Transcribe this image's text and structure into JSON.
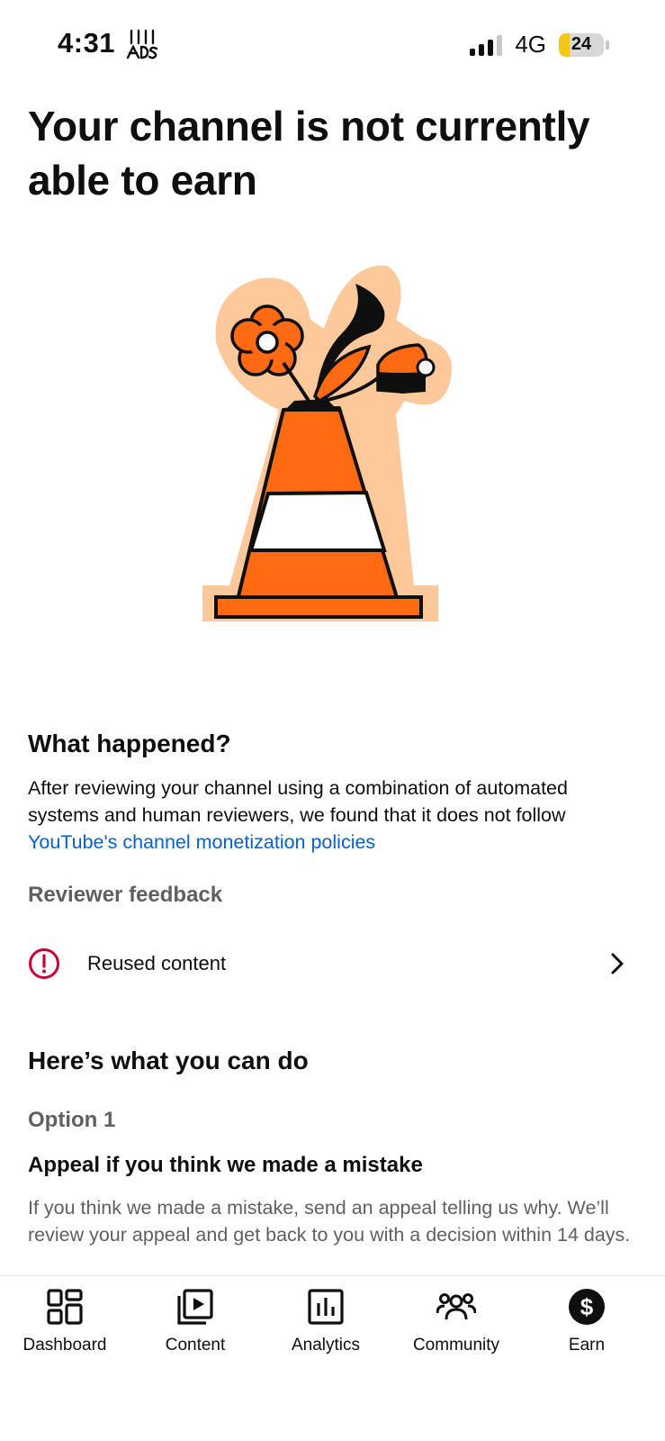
{
  "status_bar": {
    "time": "4:31",
    "network": "4G",
    "battery_level": "24",
    "battery_color": "#f5c518",
    "icons": [
      "signal-icon",
      "battery-icon"
    ]
  },
  "page": {
    "title": "Your channel is not currently able to earn",
    "illustration": "traffic-cone-with-flowers-illustration"
  },
  "what_happened": {
    "heading": "What happened?",
    "body": "After reviewing your channel using a combination of automated systems and human reviewers, we found that it does not follow",
    "link_text": "YouTube's channel monetization policies",
    "link_color": "#065fd4"
  },
  "reviewer_feedback": {
    "heading": "Reviewer feedback",
    "items": [
      {
        "label": "Reused content",
        "icon": "alert-circle-icon",
        "icon_color": "#cc0033"
      }
    ]
  },
  "what_you_can_do": {
    "heading": "Here’s what you can do",
    "option_label": "Option 1",
    "option_title": "Appeal if you think we made a mistake",
    "option_body": "If you think we made a mistake, send an appeal telling us why. We’ll review your appeal and get back to you with a decision within 14 days."
  },
  "bottom_nav": {
    "items": [
      {
        "label": "Dashboard",
        "icon": "dashboard-icon"
      },
      {
        "label": "Content",
        "icon": "content-icon"
      },
      {
        "label": "Analytics",
        "icon": "analytics-icon"
      },
      {
        "label": "Community",
        "icon": "community-icon"
      },
      {
        "label": "Earn",
        "icon": "earn-icon",
        "active": true
      }
    ]
  }
}
